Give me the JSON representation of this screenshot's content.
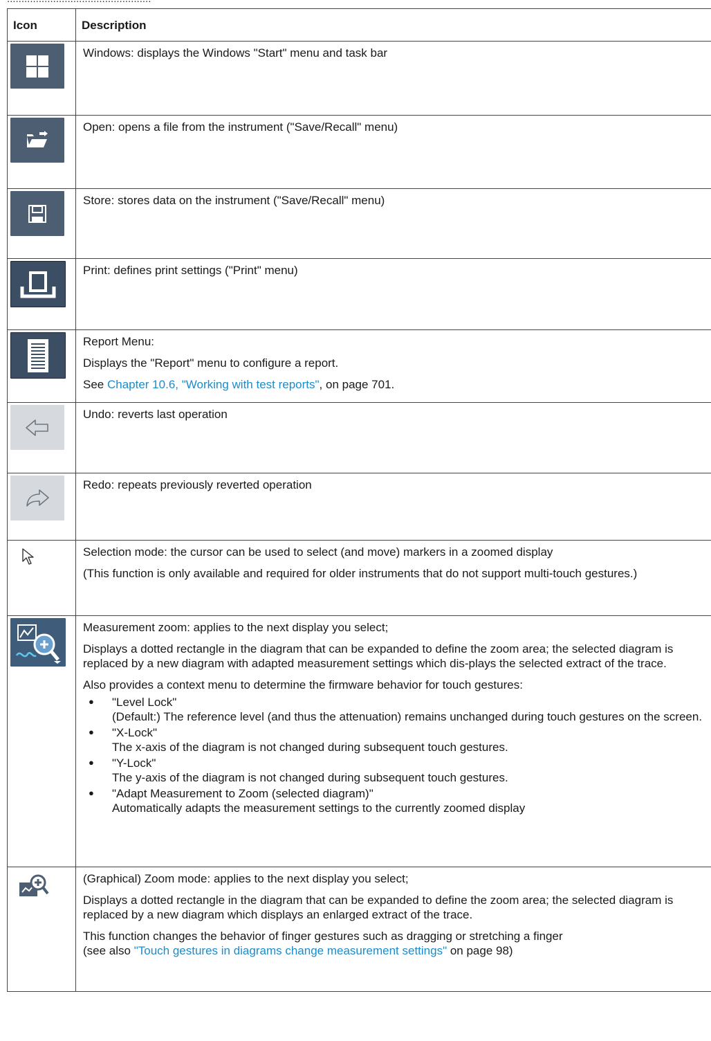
{
  "top_fragment": "..................................................",
  "table": {
    "headers": [
      "Icon",
      "Description"
    ],
    "rows": [
      {
        "icon": "windows-icon",
        "lines": [
          "Windows: displays the Windows \"Start\" menu and task bar"
        ]
      },
      {
        "icon": "open-folder-icon",
        "lines": [
          "Open: opens a file from the instrument (\"Save/Recall\" menu)"
        ]
      },
      {
        "icon": "floppy-disk-icon",
        "lines": [
          "Store: stores data on the instrument (\"Save/Recall\" menu)"
        ]
      },
      {
        "icon": "printer-icon",
        "lines": [
          "Print: defines print settings (\"Print\" menu)"
        ]
      },
      {
        "icon": "report-document-icon",
        "lines": [
          "Report Menu:",
          "Displays the \"Report\" menu to configure a report."
        ],
        "see": {
          "prefix": "See ",
          "link": "Chapter 10.6, \"Working with test reports\"",
          "suffix": ", on page 701."
        }
      },
      {
        "icon": "undo-arrow-icon",
        "lines": [
          "Undo: reverts last operation"
        ]
      },
      {
        "icon": "redo-arrow-icon",
        "lines": [
          "Redo: repeats previously reverted operation"
        ]
      },
      {
        "icon": "cursor-arrow-icon",
        "lines": [
          "Selection mode: the cursor can be used to select (and move) markers in a zoomed display",
          "(This function is only available and required for older instruments that do not support multi-touch gestures.)"
        ]
      },
      {
        "icon": "measurement-zoom-icon",
        "lines": [
          "Measurement zoom: applies to the next display you select;",
          "Displays a dotted rectangle in the diagram that can be expanded to define the zoom area; the selected diagram is replaced by a new diagram with adapted measurement settings which dis-plays the selected extract of the trace.",
          "Also provides a context menu to determine the firmware behavior for touch gestures:"
        ],
        "bullets": [
          {
            "title": "\"Level Lock\"",
            "text": "(Default:) The reference level (and thus the attenuation) remains unchanged during touch gestures on the screen."
          },
          {
            "title": "\"X-Lock\"",
            "text": "The x-axis of the diagram is not changed during subsequent touch gestures."
          },
          {
            "title": "\"Y-Lock\"",
            "text": "The y-axis of the diagram is not changed during subsequent touch gestures."
          },
          {
            "title": "\"Adapt Measurement to Zoom (selected diagram)\"",
            "text": "Automatically adapts the measurement settings to the currently zoomed display"
          }
        ]
      },
      {
        "icon": "graphical-zoom-icon",
        "lines": [
          "(Graphical) Zoom mode: applies to the next display you select;",
          "Displays a dotted rectangle in the diagram that can be expanded to define the zoom area; the selected diagram is replaced by a new diagram which displays an enlarged extract of the trace.",
          "This function changes the behavior of finger gestures such as dragging or stretching a finger"
        ],
        "see": {
          "prefix": "(see also ",
          "link": "\"Touch gestures in diagrams change measurement settings\"",
          "suffix": " on page 98)"
        }
      }
    ]
  }
}
